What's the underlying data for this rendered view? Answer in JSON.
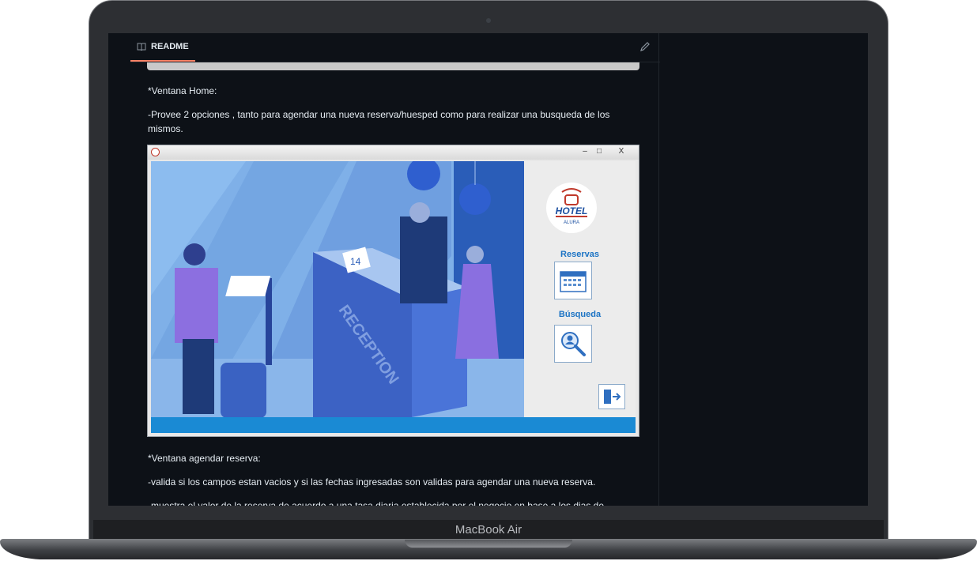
{
  "device": {
    "brand": "MacBook Air"
  },
  "readme": {
    "tab_label": "README"
  },
  "content": {
    "p1": "*Ventana Home:",
    "p2": "-Provee 2 opciones , tanto para agendar una nueva reserva/huesped como para realizar una busqueda de los mismos.",
    "p3": "*Ventana agendar reserva:",
    "p4": "-valida si los campos estan vacios y si las fechas ingresadas son validas para agendar una nueva reserva.",
    "p5": "-muestra el valor de la reserva de acuerdo a una tasa diaria establecida por el negocio en base a los dias de"
  },
  "app": {
    "window_buttons": {
      "minimize": "–",
      "maximize": "□",
      "close": "X"
    },
    "logo_text": "HOTEL",
    "logo_sub": "ALURA",
    "reservas_label": "Reservas",
    "busqueda_label": "Búsqueda",
    "illustration": {
      "desk_text": "RECEPTION",
      "calendar_day": "14"
    }
  },
  "colors": {
    "accent_tab": "#f78166",
    "app_blue": "#1b73c4",
    "screen_bg": "#0d1117"
  }
}
